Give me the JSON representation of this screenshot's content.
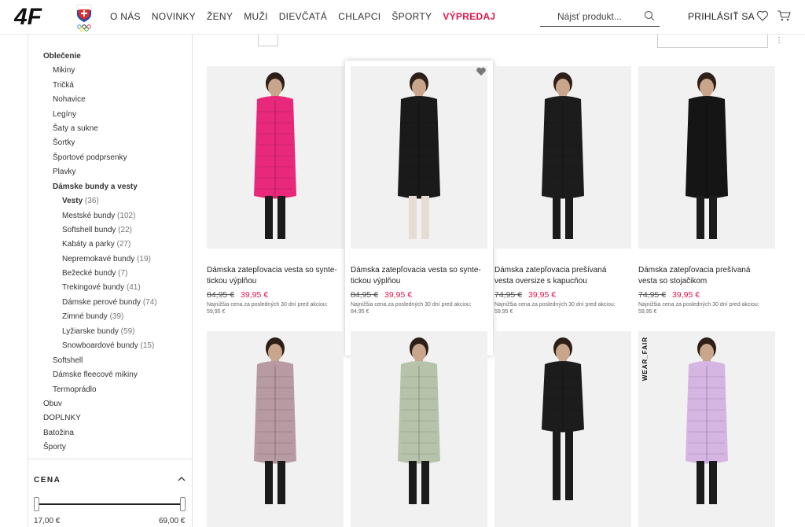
{
  "header": {
    "logo": "4F",
    "nav": [
      "O NÁS",
      "NOVINKY",
      "ŽENY",
      "MUŽI",
      "DIEVČATÁ",
      "CHLAPCI",
      "ŠPORTY",
      "VÝPREDAJ"
    ],
    "search_placeholder": "Nájsť produkt...",
    "login": "PRIHLÁSIŤ SA",
    "icons": [
      "search-icon",
      "heart-icon",
      "cart-icon"
    ]
  },
  "sidebar": {
    "items": [
      {
        "label": "Oblečenie",
        "bold": true
      },
      {
        "label": "Mikiny"
      },
      {
        "label": "Tričká"
      },
      {
        "label": "Nohavice"
      },
      {
        "label": "Legíny"
      },
      {
        "label": "Šaty a sukne"
      },
      {
        "label": "Šortky"
      },
      {
        "label": "Športové podprsenky"
      },
      {
        "label": "Plavky"
      },
      {
        "label": "Dámske bundy a vesty",
        "bold": true
      },
      {
        "label": "Vesty",
        "count": "(36)",
        "bold": true
      },
      {
        "label": "Mestské bundy",
        "count": "(102)"
      },
      {
        "label": "Softshell bundy",
        "count": "(22)"
      },
      {
        "label": "Kabáty a parky",
        "count": "(27)"
      },
      {
        "label": "Nepremokavé bundy",
        "count": "(19)"
      },
      {
        "label": "Bežecké bundy",
        "count": "(7)"
      },
      {
        "label": "Trekingové bundy",
        "count": "(41)"
      },
      {
        "label": "Dámske perové bundy",
        "count": "(74)"
      },
      {
        "label": "Zimné bundy",
        "count": "(39)"
      },
      {
        "label": "Lyžiarske bundy",
        "count": "(59)"
      },
      {
        "label": "Snowboardové bundy",
        "count": "(15)"
      },
      {
        "label": "Softshell"
      },
      {
        "label": "Dámske fleecové mikiny"
      },
      {
        "label": "Termoprádlo"
      },
      {
        "label": "Obuv"
      },
      {
        "label": "DOPLNKY"
      },
      {
        "label": "Batožina"
      },
      {
        "label": "Športy"
      }
    ],
    "price_filter": {
      "label": "CENA",
      "min": "17,00 €",
      "max": "69,00 €"
    }
  },
  "products": [
    {
      "title1": "Dámska zatepľovacia vesta so synte-",
      "title2": "tickou výplňou",
      "old": "84,95 €",
      "new": "39,95 €",
      "note1": "Najnižšia cena za posledných 30 dní pred akciou:",
      "note2": "59,95 €",
      "color": "#e8287a"
    },
    {
      "title1": "Dámska zatepľovacia vesta so synte-",
      "title2": "tickou výplňou",
      "old": "84,95 €",
      "new": "39,95 €",
      "note1": "Najnižšia cena za posledných 30 dní pred akciou:",
      "note2": "84,95 €",
      "color": "#1a1a1a"
    },
    {
      "title1": "Dámska zatepľovacia prešívaná",
      "title2": "vesta oversize s kapucňou",
      "old": "74,95 €",
      "new": "39,95 €",
      "note1": "Najnižšia cena za posledných 30 dní pred akciou:",
      "note2": "59,95 €",
      "color": "#1c1c1c"
    },
    {
      "title1": "Dámska zatepľovacia prešívaná",
      "title2": "vesta so stojačikom",
      "old": "74,95 €",
      "new": "39,95 €",
      "note1": "Najnižšia cena za posledných 30 dní pred akciou:",
      "note2": "59,95 €",
      "color": "#151515"
    }
  ],
  "row2": [
    {
      "color": "#b89aa3"
    },
    {
      "color": "#b7c2ab"
    },
    {
      "color": "#1c1c1c"
    },
    {
      "color": "#d5b6e3"
    }
  ],
  "wear_label": "WEAR_FAIR",
  "colors": {
    "sale": "#e3174a",
    "swatch1": "#111111",
    "swatch2": "#e8d4b0"
  }
}
